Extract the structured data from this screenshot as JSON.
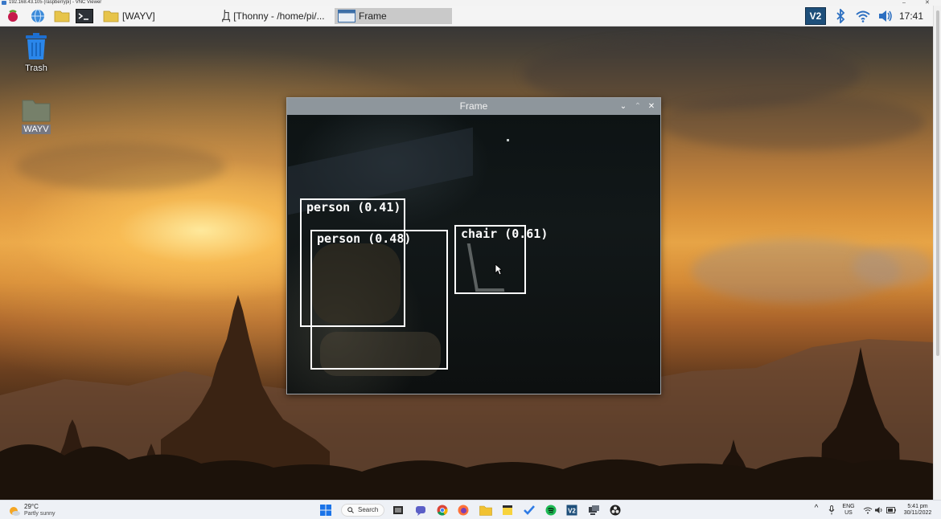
{
  "vnc": {
    "title": "192.168.43.105 (raspberrypi) - VNC Viewer",
    "minimize_glyph": "–",
    "maximize_glyph": "☐",
    "close_glyph": "✕"
  },
  "panel": {
    "menu_icon": "raspberry-icon",
    "browser_icon": "globe-icon",
    "files_icon": "folder-icon",
    "terminal_icon": "terminal-icon",
    "taskbar_items": [
      {
        "label": "[WAYV]",
        "icon": "folder-icon",
        "active": false
      },
      {
        "label": "[Thonny  -  /home/pi/...",
        "icon": "thonny-icon",
        "active": false
      },
      {
        "label": "Frame",
        "icon": "window-icon",
        "active": true
      }
    ],
    "tray": {
      "vnc_icon": "vnc-icon",
      "vnc_text": "V2",
      "bluetooth_icon": "bluetooth-icon",
      "wifi_icon": "wifi-icon",
      "volume_icon": "volume-icon",
      "clock": "17:41"
    }
  },
  "desktop": {
    "icons": [
      {
        "label": "Trash",
        "icon": "trash-icon",
        "selected": false
      },
      {
        "label": "WAYV",
        "icon": "folder-icon",
        "selected": true
      }
    ]
  },
  "frame_window": {
    "title": "Frame",
    "controls": {
      "minimize": "⌄",
      "maximize": "⌃",
      "close": "✕"
    },
    "detections": [
      {
        "label": "person (0.41)"
      },
      {
        "label": "person (0.48)"
      },
      {
        "label": "chair (0.61)"
      }
    ]
  },
  "windows_taskbar": {
    "weather": {
      "temp": "29°C",
      "desc": "Partly sunny",
      "icon": "sun-cloud-icon"
    },
    "search_label": "Search",
    "apps": [
      "windows-start-icon",
      "search-icon",
      "task-view-icon",
      "teams-chat-icon",
      "chrome-icon",
      "firefox-icon",
      "file-explorer-icon",
      "sticky-notes-icon",
      "todo-icon",
      "spotify-icon",
      "vnc-icon",
      "remote-desktop-icon",
      "obs-icon"
    ],
    "tray": {
      "chevron": "^",
      "lang_top": "ENG",
      "lang_bottom": "US",
      "time": "5:41 pm",
      "date": "30/11/2022"
    }
  },
  "colors": {
    "panel_bg": "#f4f4f4",
    "frame_titlebar": "#8e969c",
    "box_color": "#ffffff",
    "vnc_brand": "#1e4f7a"
  }
}
